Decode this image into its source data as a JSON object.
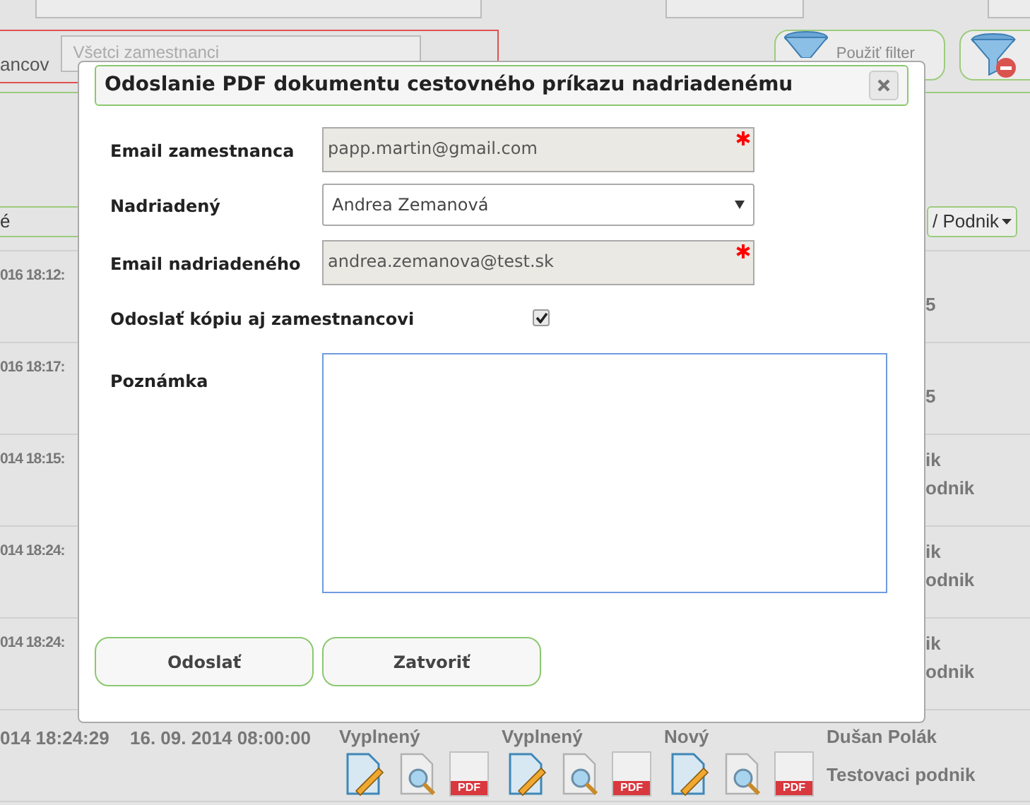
{
  "filter": {
    "employee_label": "ancov",
    "employee_select": "Všetci zamestnanci",
    "apply_button": "Použiť filter"
  },
  "table": {
    "header_left": "é",
    "header_right": "/ Podnik",
    "rows": [
      {
        "date": "016 18:12:",
        "right_2": "5"
      },
      {
        "date": "016 18:17:",
        "right_2": "5"
      },
      {
        "date": "014 18:15:",
        "right_1": "ik",
        "right_2": "odnik"
      },
      {
        "date": "014 18:24:",
        "right_1": "ik",
        "right_2": "odnik"
      },
      {
        "date": "014 18:24:",
        "right_1": "ik",
        "right_2": "odnik"
      }
    ],
    "last_row": {
      "created": "014 18:24:29",
      "date": "16. 09. 2014 08:00:00",
      "statuses": [
        {
          "label": "Vyplnený",
          "pdf_badge": "PDF"
        },
        {
          "label": "Vyplnený",
          "pdf_badge": "PDF"
        },
        {
          "label": "Nový",
          "pdf_badge": "PDF"
        }
      ],
      "name": "Dušan Polák",
      "company": "Testovaci podnik"
    }
  },
  "dialog": {
    "title": "Odoslanie PDF dokumentu cestovného príkazu nadriadenému",
    "fields": [
      {
        "kind": "readonly",
        "label": "Email zamestnanca",
        "value": "papp.martin@gmail.com",
        "required": true
      },
      {
        "kind": "select",
        "label": "Nadriadený",
        "value": "Andrea Zemanová"
      },
      {
        "kind": "readonly",
        "label": "Email nadriadeného",
        "value": "andrea.zemanova@test.sk",
        "required": true
      },
      {
        "kind": "checkbox",
        "label": "Odoslať kópiu aj zamestnancovi",
        "checked": true
      },
      {
        "kind": "textarea",
        "label": "Poznámka"
      }
    ],
    "buttons": [
      "Odoslať",
      "Zatvoriť"
    ]
  }
}
